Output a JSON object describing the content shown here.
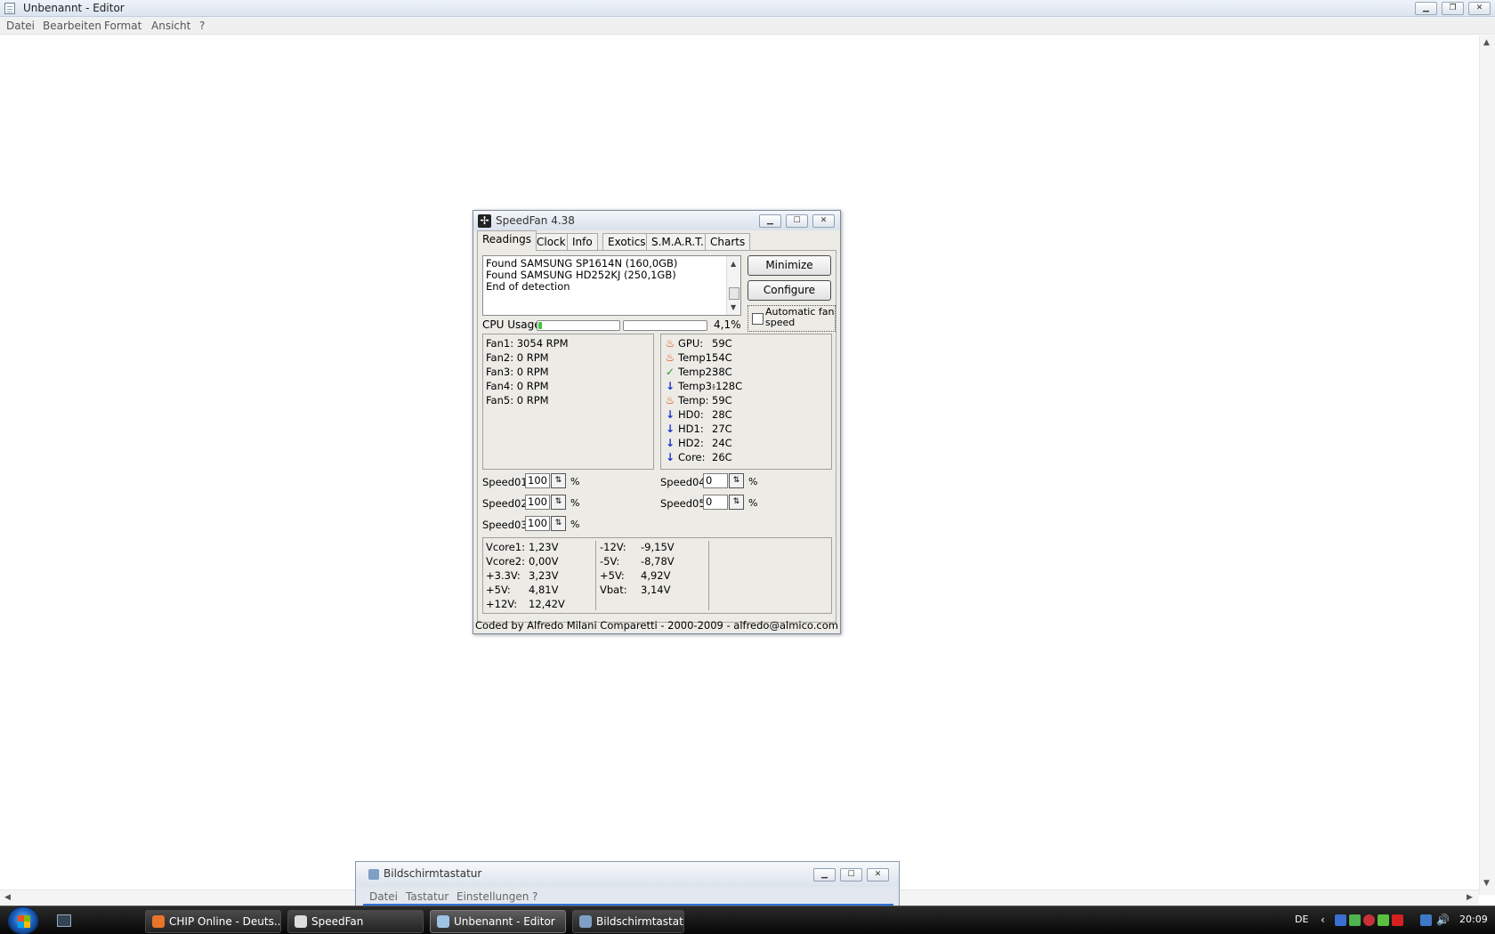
{
  "notepad": {
    "title": "Unbenannt - Editor",
    "menu": [
      "Datei",
      "Bearbeiten",
      "Format",
      "Ansicht",
      "?"
    ]
  },
  "speedfan": {
    "title": "SpeedFan 4.38",
    "tabs": [
      "Readings",
      "Clock",
      "Info",
      "Exotics",
      "S.M.A.R.T.",
      "Charts"
    ],
    "log": [
      "Found SAMSUNG SP1614N (160,0GB)",
      "Found SAMSUNG HD252KJ (250,1GB)",
      "End of detection"
    ],
    "buttons": {
      "minimize": "Minimize",
      "configure": "Configure"
    },
    "auto_fan_label": "Automatic fan speed",
    "cpu_usage_label": "CPU Usage",
    "cpu_usage_value": "4,1%",
    "cpu_bar1_fraction": 0.041,
    "cpu_bar2_fraction": 0.0,
    "fans": [
      "Fan1: 3054 RPM",
      "Fan2: 0 RPM",
      "Fan3: 0 RPM",
      "Fan4: 0 RPM",
      "Fan5: 0 RPM"
    ],
    "temps": [
      {
        "label": "GPU:",
        "value": "59C",
        "icon": "flame-icon"
      },
      {
        "label": "Temp1:",
        "value": "54C",
        "icon": "flame-icon"
      },
      {
        "label": "Temp2:",
        "value": "38C",
        "icon": "check-icon"
      },
      {
        "label": "Temp3:",
        "value": "-128C",
        "icon": "arrow-down-icon"
      },
      {
        "label": "Temp:",
        "value": "59C",
        "icon": "flame-icon"
      },
      {
        "label": "HD0:",
        "value": "28C",
        "icon": "arrow-down-icon"
      },
      {
        "label": "HD1:",
        "value": "27C",
        "icon": "arrow-down-icon"
      },
      {
        "label": "HD2:",
        "value": "24C",
        "icon": "arrow-down-icon"
      },
      {
        "label": "Core:",
        "value": "26C",
        "icon": "arrow-down-icon"
      }
    ],
    "speeds": [
      {
        "label": "Speed01:",
        "value": "100"
      },
      {
        "label": "Speed02:",
        "value": "100"
      },
      {
        "label": "Speed03:",
        "value": "100"
      },
      {
        "label": "Speed04:",
        "value": "0"
      },
      {
        "label": "Speed05:",
        "value": "0"
      }
    ],
    "percent_sign": "%",
    "voltages_left": [
      {
        "label": "Vcore1:",
        "value": "1,23V"
      },
      {
        "label": "Vcore2:",
        "value": "0,00V"
      },
      {
        "label": "+3.3V:",
        "value": "3,23V"
      },
      {
        "label": "+5V:",
        "value": "4,81V"
      },
      {
        "label": "+12V:",
        "value": "12,42V"
      }
    ],
    "voltages_right": [
      {
        "label": "-12V:",
        "value": "-9,15V"
      },
      {
        "label": "-5V:",
        "value": "-8,78V"
      },
      {
        "label": "+5V:",
        "value": "4,92V"
      },
      {
        "label": "Vbat:",
        "value": "3,14V"
      }
    ],
    "footer": "Coded by Alfredo Milani Comparetti - 2000-2009 - alfredo@almico.com"
  },
  "osk": {
    "title": "Bildschirmtastatur",
    "menu": [
      "Datei",
      "Tastatur",
      "Einstellungen",
      "?"
    ]
  },
  "taskbar": {
    "items": [
      {
        "label": "CHIP Online - Deuts...",
        "icon": "firefox-icon",
        "color": "#e8742a"
      },
      {
        "label": "SpeedFan",
        "icon": "fan-icon",
        "color": "#dddddd"
      },
      {
        "label": "Unbenannt - Editor",
        "icon": "notepad-icon",
        "color": "#9fc3e6"
      },
      {
        "label": "Bildschirmtastatur",
        "icon": "keyboard-icon",
        "color": "#7fa0c4"
      }
    ],
    "language": "DE",
    "clock": "20:09"
  }
}
